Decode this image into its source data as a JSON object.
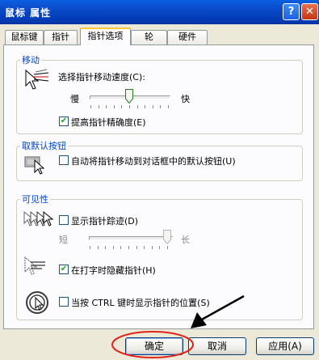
{
  "window": {
    "title": "鼠标 属性"
  },
  "tabs": [
    {
      "label": "鼠标键"
    },
    {
      "label": "指针"
    },
    {
      "label": "指针选项"
    },
    {
      "label": "轮"
    },
    {
      "label": "硬件"
    }
  ],
  "active_tab": "指针选项",
  "motion": {
    "legend": "移动",
    "speed_label": "选择指针移动速度(C):",
    "slow_label": "慢",
    "fast_label": "快",
    "speed_level": 0.5,
    "precision_label": "提高指针精确度(E)",
    "precision_checked": true
  },
  "snap": {
    "legend": "取默认按钮",
    "label": "自动将指针移动到对话框中的默认按钮(U)",
    "checked": false
  },
  "visibility": {
    "legend": "可见性",
    "trails_label": "显示指针踪迹(D)",
    "trails_checked": false,
    "short_label": "短",
    "long_label": "长",
    "trail_level": 1.0,
    "hide_label": "在打字时隐藏指针(H)",
    "hide_checked": true,
    "ctrl_label": "当按 CTRL 键时显示指针的位置(S)",
    "ctrl_checked": false
  },
  "buttons": {
    "ok": "确定",
    "cancel": "取消",
    "apply": "应用(A)"
  },
  "colors": {
    "titlebar": "#0a49c8",
    "annotation_red": "#e0221a",
    "legend_blue": "#0046d5"
  }
}
